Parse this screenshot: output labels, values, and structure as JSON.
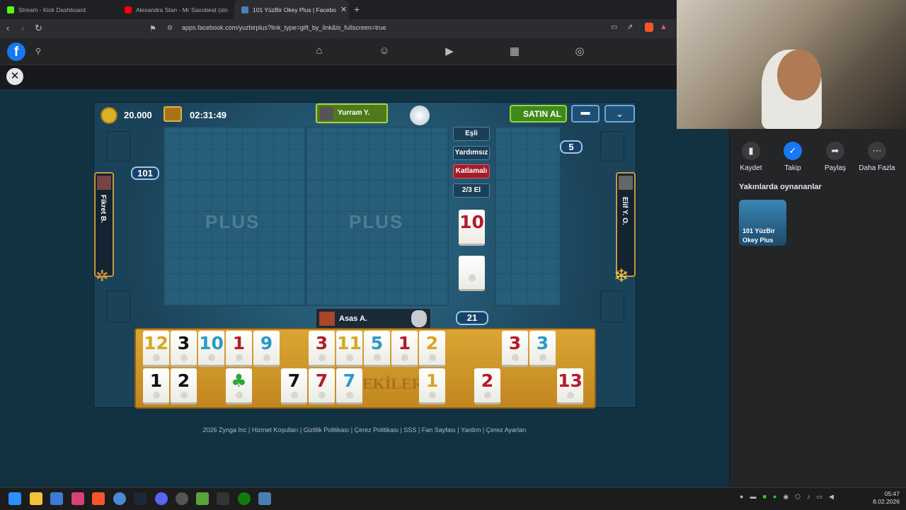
{
  "browser": {
    "tabs": [
      {
        "title": "Stream - Kick Dashboard",
        "favicon_color": "#53fc18"
      },
      {
        "title": "Alexandra Stan - Mr Saxobeat (slo",
        "favicon_color": "#ff0000"
      },
      {
        "title": "101 YüzBir Okey Plus | Facebo",
        "favicon_color": "#4a7fb5"
      }
    ],
    "url": "apps.facebook.com/yuzbirplus?link_type=gift_by_link&is_fullscreen=true"
  },
  "game": {
    "coins": "20.000",
    "timer": "02:31:49",
    "buy_label": "SATIN AL",
    "top_player": "Yurram Y.",
    "left_player": "Fikret B.",
    "right_player": "Elif Y. O.",
    "bottom_player": "Asas A.",
    "left_score": "101",
    "right_count": "5",
    "remaining_tiles": "21",
    "rules": [
      "Eşli",
      "Yardımsız",
      "Katlamalı",
      "2/3 El"
    ],
    "indicator_tile": {
      "value": "10",
      "color": "red"
    },
    "plus_text": "PLUS",
    "rack_brand": "EKİLER",
    "rack_row1": [
      {
        "v": "12",
        "c": "yellow"
      },
      {
        "v": "3",
        "c": "black"
      },
      {
        "v": "10",
        "c": "blue"
      },
      {
        "v": "1",
        "c": "red"
      },
      {
        "v": "9",
        "c": "blue"
      },
      {
        "v": "",
        "c": "gap"
      },
      {
        "v": "3",
        "c": "red"
      },
      {
        "v": "11",
        "c": "yellow"
      },
      {
        "v": "5",
        "c": "blue"
      },
      {
        "v": "1",
        "c": "red"
      },
      {
        "v": "2",
        "c": "yellow"
      },
      {
        "v": "",
        "c": "gap"
      },
      {
        "v": "",
        "c": "gap"
      },
      {
        "v": "3",
        "c": "red"
      },
      {
        "v": "3",
        "c": "blue"
      }
    ],
    "rack_row2": [
      {
        "v": "1",
        "c": "black"
      },
      {
        "v": "2",
        "c": "black"
      },
      {
        "v": "",
        "c": "gap"
      },
      {
        "v": "♣",
        "c": "green"
      },
      {
        "v": "",
        "c": "gap"
      },
      {
        "v": "7",
        "c": "black"
      },
      {
        "v": "7",
        "c": "red"
      },
      {
        "v": "7",
        "c": "blue"
      },
      {
        "v": "",
        "c": "gap"
      },
      {
        "v": "",
        "c": "gap"
      },
      {
        "v": "1",
        "c": "yellow"
      },
      {
        "v": "",
        "c": "gap"
      },
      {
        "v": "2",
        "c": "red"
      },
      {
        "v": "",
        "c": "gap"
      },
      {
        "v": "",
        "c": "gap"
      },
      {
        "v": "13",
        "c": "red"
      }
    ]
  },
  "footer": "2026 Zynga Inc | Hizmet Koşulları | Gizlilik Politikası | Çerez Politikası | SSS | Fan Sayfası | Yardım | Çerez Ayarları",
  "sidebar": {
    "buttons": [
      "Kaydet",
      "Takip",
      "Paylaş",
      "Daha Fazla"
    ],
    "recent_title": "Yakınlarda oynananlar",
    "recent_game": "101 YüzBir Okey Plus"
  },
  "clock": {
    "time": "05:47",
    "date": "8.02.2026"
  }
}
